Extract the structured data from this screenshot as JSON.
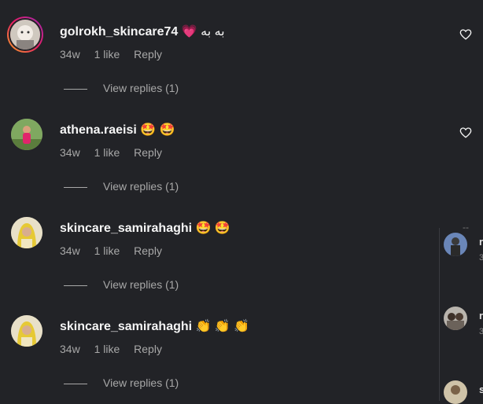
{
  "comments": [
    {
      "username": "golrokh_skincare74",
      "text": "💗 به به",
      "time": "34w",
      "likes": "1 like",
      "reply": "Reply",
      "view_replies": "View replies (1)"
    },
    {
      "username": "athena.raeisi",
      "text": "🤩 🤩",
      "time": "34w",
      "likes": "1 like",
      "reply": "Reply",
      "view_replies": "View replies (1)"
    },
    {
      "username": "skincare_samirahaghi",
      "text": "🤩 🤩",
      "time": "34w",
      "likes": "1 like",
      "reply": "Reply",
      "view_replies": "View replies (1)"
    },
    {
      "username": "skincare_samirahaghi",
      "text": "👏 👏 👏",
      "time": "34w",
      "likes": "1 like",
      "reply": "Reply",
      "view_replies": "View replies (1)"
    }
  ],
  "side_panel": {
    "dash": "--",
    "items": [
      {
        "name": "r",
        "sub": "3"
      },
      {
        "name": "r",
        "sub": "3"
      },
      {
        "name": "s",
        "sub": ""
      }
    ]
  },
  "colors": {
    "background": "#222327",
    "text_primary": "#f5f5f5",
    "text_secondary": "#a8a8a8"
  },
  "icons": {
    "like": "heart-outline-icon"
  }
}
